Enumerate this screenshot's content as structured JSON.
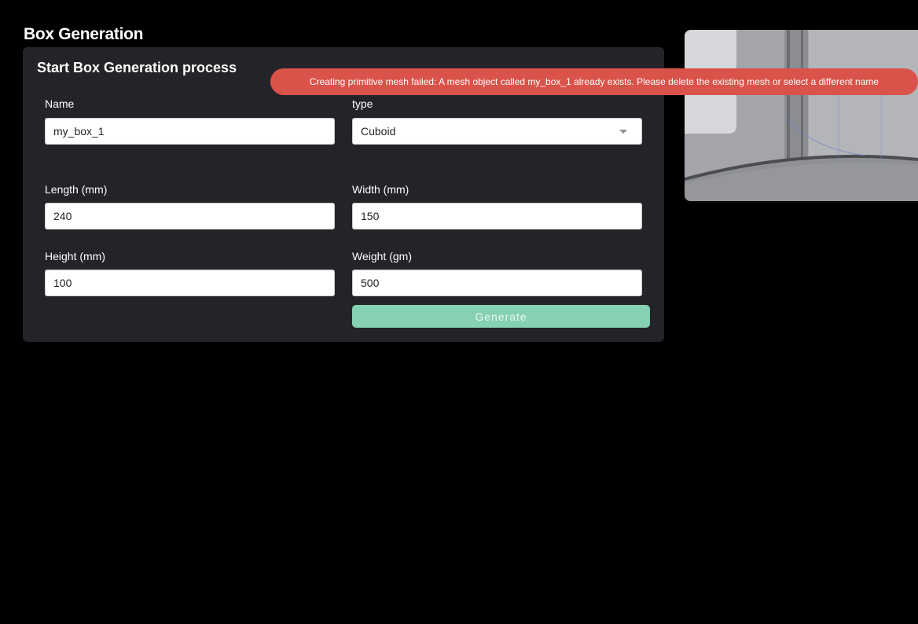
{
  "page": {
    "title": "Box Generation"
  },
  "panel": {
    "title": "Start Box Generation process",
    "fields": {
      "name": {
        "label": "Name",
        "value": "my_box_1"
      },
      "type": {
        "label": "type",
        "value": "Cuboid"
      },
      "length": {
        "label": "Length (mm)",
        "value": "240"
      },
      "width": {
        "label": "Width (mm)",
        "value": "150"
      },
      "height": {
        "label": "Height (mm)",
        "value": "100"
      },
      "weight": {
        "label": "Weight (gm)",
        "value": "500"
      }
    },
    "generate_label": "Generate"
  },
  "toast": {
    "message": "Creating primitive mesh failed: A mesh object called my_box_1 already exists. Please delete the existing mesh or select a different name"
  },
  "colors": {
    "background": "#000000",
    "panel": "#242428",
    "accent": "#86d1b2",
    "error": "#d9534a"
  },
  "icons": {
    "select_caret": "chevron-down-icon"
  }
}
